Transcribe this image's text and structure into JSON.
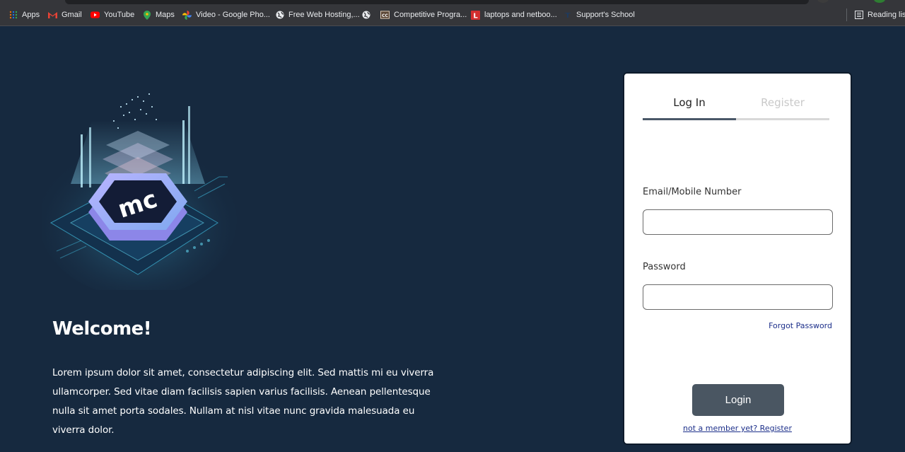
{
  "bookmarks": {
    "items": [
      {
        "label": "Apps",
        "icon": "apps-grid-icon"
      },
      {
        "label": "Gmail",
        "icon": "gmail-icon"
      },
      {
        "label": "YouTube",
        "icon": "youtube-icon"
      },
      {
        "label": "Maps",
        "icon": "maps-icon"
      },
      {
        "label": "Video - Google Pho...",
        "icon": "google-photos-icon"
      },
      {
        "label": "Free Web Hosting,...",
        "icon": "globe-icon"
      },
      {
        "label": "",
        "icon": "globe-icon"
      },
      {
        "label": "Competitive Progra...",
        "icon": "cc-icon"
      },
      {
        "label": "laptops and netboo...",
        "icon": "l-icon"
      },
      {
        "label": "Support's School",
        "icon": "school-icon"
      }
    ],
    "reading_list": "Reading list"
  },
  "hero": {
    "title": "Welcome!",
    "text": "Lorem ipsum dolor sit amet, consectetur adipiscing elit. Sed mattis mi eu viverra ullamcorper. Sed vitae diam facilisis sapien varius facilisis. Aenean pellentesque nulla sit amet porta sodales. Nullam at nisl vitae nunc gravida malesuada eu viverra dolor."
  },
  "auth": {
    "tab_login": "Log In",
    "tab_register": "Register",
    "email_label": "Email/Mobile Number",
    "email_value": "",
    "password_label": "Password",
    "password_value": "",
    "forgot_label": "Forgot Password",
    "login_button": "Login",
    "register_link": "not a member yet? Register"
  },
  "colors": {
    "page_bg": "#16293f",
    "button_bg": "#4a5662",
    "link": "#1c2f8a",
    "active_tab_underline": "#4a5868"
  }
}
